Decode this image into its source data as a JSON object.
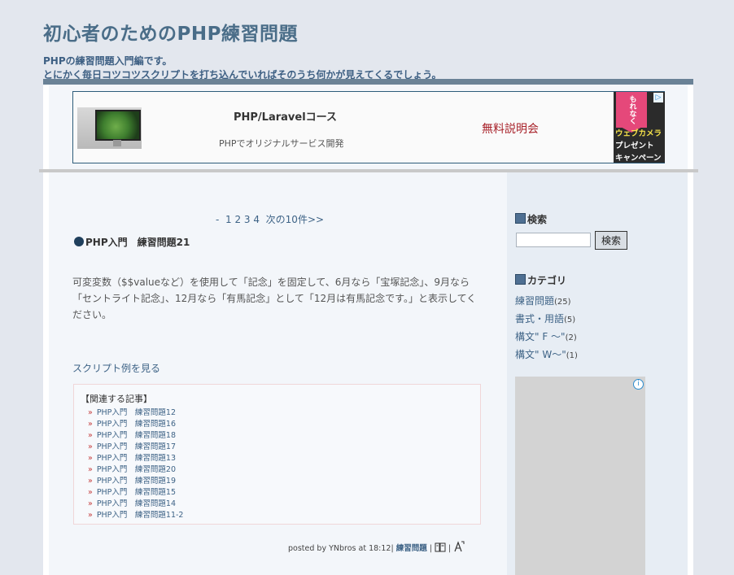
{
  "site": {
    "title": "初心者のためのPHP練習問題",
    "desc_line1": "PHPの練習問題入門編です。",
    "desc_line2": "とにかく毎日コツコツスクリプトを打ち込んでいればそのうち何かが見えてくるでしょう。"
  },
  "ad": {
    "title": "PHP/Laravelコース",
    "subtitle": "PHPでオリジナルサービス開発",
    "cta": "無料説明会",
    "banner_line1": "もれなく",
    "banner_line2": "ウェブカメラ",
    "banner_line3": "プレゼント",
    "banner_line4": "キャンペーン",
    "adchoices": "▷"
  },
  "pager": {
    "prefix": "-",
    "pages": [
      "1",
      "2",
      "3",
      "4"
    ],
    "next": "次の10件>>"
  },
  "post": {
    "title": "PHP入門　練習問題21",
    "body": "可変変数（$$valueなど）を使用して「記念」を固定して、6月なら「宝塚記念」、9月なら「セントライト記念」、12月なら「有馬記念」として「12月は有馬記念です。」と表示してください。",
    "script_link": "スクリプト例を見る"
  },
  "related": {
    "heading": "【関連する記事】",
    "bullet": "»",
    "items": [
      "PHP入門　練習問題12",
      "PHP入門　練習問題16",
      "PHP入門　練習問題18",
      "PHP入門　練習問題17",
      "PHP入門　練習問題13",
      "PHP入門　練習問題20",
      "PHP入門　練習問題19",
      "PHP入門　練習問題15",
      "PHP入門　練習問題14",
      "PHP入門　練習問題11-2"
    ]
  },
  "footer": {
    "posted": "posted by YNbros at 18:12|",
    "category": "練習問題",
    "sep1": "|",
    "sep2": "|"
  },
  "sidebar": {
    "search_heading": "検索",
    "search_button": "検索",
    "category_heading": "カテゴリ",
    "categories": [
      {
        "label": "練習問題",
        "count": "(25)"
      },
      {
        "label": "書式・用語",
        "count": "(5)"
      },
      {
        "label": "構文\" F ～\"",
        "count": "(2)"
      },
      {
        "label": "構文\" W～\"",
        "count": "(1)"
      }
    ],
    "ad_info": "i"
  },
  "colors": {
    "background": "#e3e7ee",
    "accent": "#4a6d88",
    "link": "#3e6386",
    "cta": "#a8222a"
  }
}
